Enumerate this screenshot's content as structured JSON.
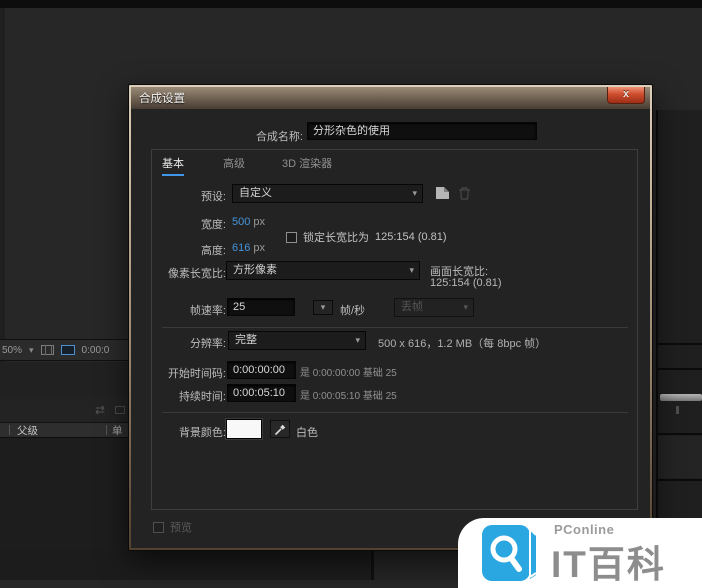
{
  "workspace": {
    "toolbar": {
      "zoom_level": "50%",
      "timecode": "0:00:0"
    },
    "parent_header": {
      "label": "父级",
      "partial_right": "单"
    }
  },
  "dialog": {
    "title": "合成设置",
    "close_label": "x",
    "name": {
      "label": "合成名称:",
      "value": "分形杂色的使用"
    },
    "tabs": [
      {
        "label": "基本"
      },
      {
        "label": "高级"
      },
      {
        "label": "3D 渲染器"
      }
    ],
    "preset": {
      "label": "预设:",
      "value": "自定义"
    },
    "width": {
      "label": "宽度:",
      "value": "500",
      "unit": "px"
    },
    "height": {
      "label": "高度:",
      "value": "616",
      "unit": "px"
    },
    "lock_aspect": {
      "label": "锁定长宽比为",
      "value": "125:154 (0.81)"
    },
    "pixel_aspect": {
      "label": "像素长宽比:",
      "value": "方形像素"
    },
    "frame_aspect": {
      "label": "画面长宽比:",
      "value": "125:154 (0.81)"
    },
    "frame_rate": {
      "label": "帧速率:",
      "value": "25",
      "unit": "帧/秒",
      "drop_frame": "丢帧"
    },
    "resolution": {
      "label": "分辨率:",
      "value": "完整",
      "info": "500 x 616，1.2 MB（每 8bpc 帧）"
    },
    "start_timecode": {
      "label": "开始时间码:",
      "value": "0:00:00:00",
      "aux": "是 0:00:00:00 基础 25"
    },
    "duration": {
      "label": "持续时间:",
      "value": "0:00:05:10",
      "aux": "是 0:00:05:10 基础 25"
    },
    "background_color": {
      "label": "背景颜色:",
      "color_name": "白色",
      "color_hex": "#ffffff"
    },
    "preview": {
      "label": "预览"
    }
  },
  "watermark": {
    "brand": "PConline",
    "title": "IT百科",
    "icon_color": "#2aa7e0"
  },
  "colors": {
    "value_blue": "#4695dc",
    "tab_underline": "#3f96e8",
    "close_red": "#cd4e2e",
    "dialog_border_tan": "#c2b299",
    "workspace_bg": "#272727"
  }
}
